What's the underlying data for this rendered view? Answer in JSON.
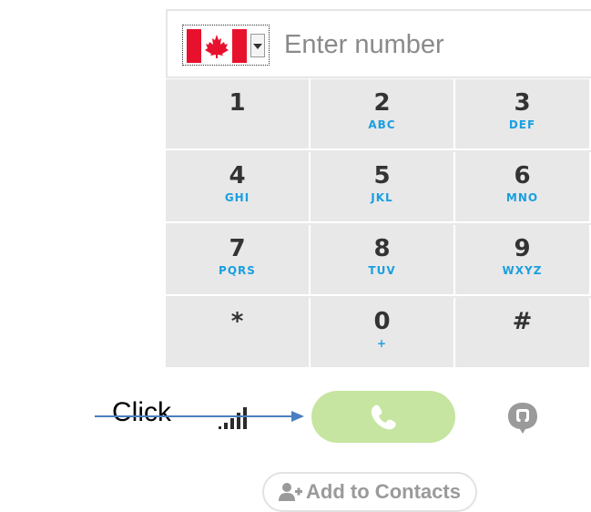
{
  "number_bar": {
    "country": "Canada",
    "flag_icon": "canada-flag-icon",
    "placeholder": "Enter number",
    "value": ""
  },
  "keypad": {
    "keys": [
      {
        "digit": "1",
        "letters": ""
      },
      {
        "digit": "2",
        "letters": "ABC"
      },
      {
        "digit": "3",
        "letters": "DEF"
      },
      {
        "digit": "4",
        "letters": "GHI"
      },
      {
        "digit": "5",
        "letters": "JKL"
      },
      {
        "digit": "6",
        "letters": "MNO"
      },
      {
        "digit": "7",
        "letters": "PQRS"
      },
      {
        "digit": "8",
        "letters": "TUV"
      },
      {
        "digit": "9",
        "letters": "WXYZ"
      },
      {
        "digit": "*",
        "letters": ""
      },
      {
        "digit": "0",
        "letters": "+"
      },
      {
        "digit": "#",
        "letters": ""
      }
    ]
  },
  "actions": {
    "signal_icon": "signal-strength-icon",
    "call_icon": "phone-icon",
    "call_color": "#c5e5a0",
    "chat_icon": "chat-bubble-icon",
    "add_contacts_label": "Add to Contacts",
    "add_contacts_icon": "add-person-icon"
  },
  "annotation": {
    "label": "Click",
    "arrow_color": "#4a7fc1"
  },
  "colors": {
    "keypad_bg": "#e8e8e8",
    "letters": "#1a9fe0",
    "digits": "#333333"
  }
}
